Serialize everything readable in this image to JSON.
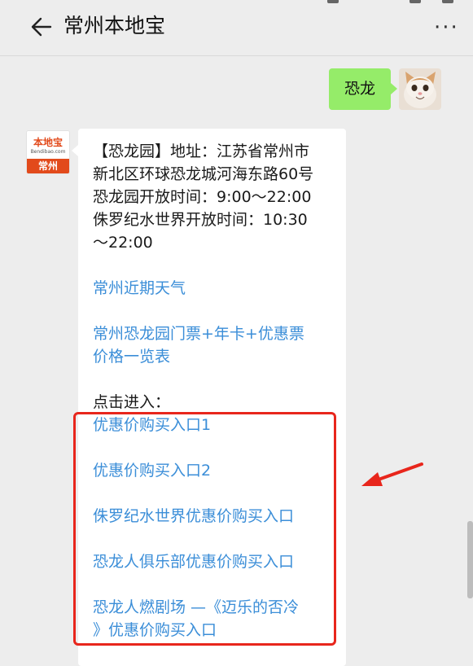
{
  "header": {
    "title": "常州本地宝",
    "back_icon": "back-arrow-icon",
    "more_icon": "more-dots-icon",
    "more_label": "···"
  },
  "outgoing": {
    "text": "恐龙",
    "avatar": "user-avatar-cat"
  },
  "incoming": {
    "avatar_brand": "本地宝",
    "avatar_domain": "Bendibao.com",
    "avatar_city": "常州",
    "info_lines": [
      "【恐龙园】地址：江苏省常州市",
      "新北区环球恐龙城河海东路60号",
      "恐龙园开放时间：9:00～22:00",
      "侏罗纪水世界开放时间：10:30",
      "～22:00"
    ],
    "link_weather": "常州近期天气",
    "link_ticket_1": "常州恐龙园门票+年卡+优惠票",
    "link_ticket_2": "价格一览表",
    "enter_label": "点击进入：",
    "purchase_links": [
      "优惠价购买入口1",
      "优惠价购买入口2",
      "侏罗纪水世界优惠价购买入口",
      "恐龙人俱乐部优惠价购买入口",
      "恐龙人燃剧场 —《迈乐的否冷",
      "》优惠价购买入口"
    ]
  },
  "colors": {
    "bubble_out": "#95ec69",
    "link": "#3b8ed8",
    "highlight_box": "#e8261c",
    "brand": "#e24a1b"
  }
}
